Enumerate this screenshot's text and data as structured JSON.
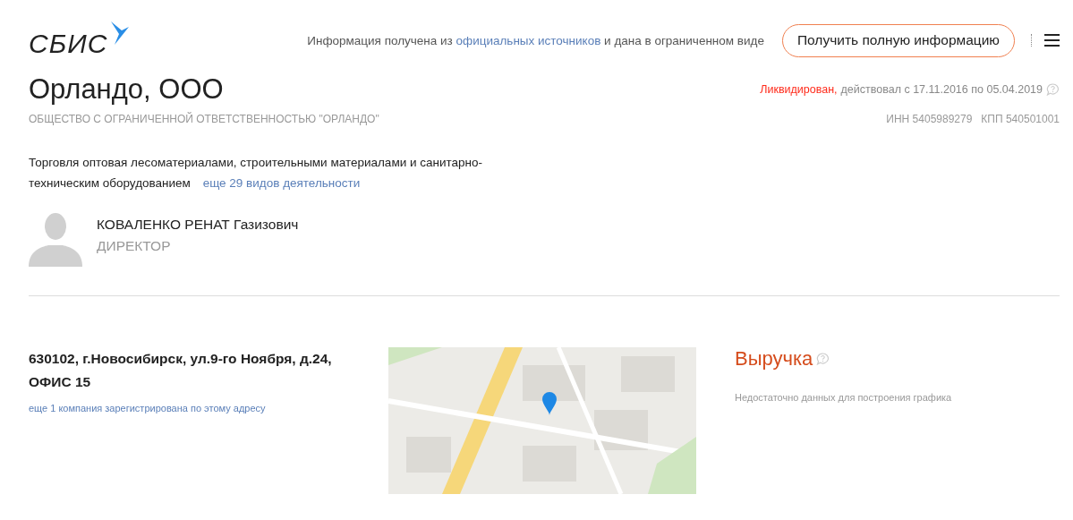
{
  "header": {
    "logo": "СБИС",
    "notice_before": "Информация получена из",
    "notice_link": "официальных источников",
    "notice_after": "и дана в ограниченном виде",
    "button": "Получить полную информацию"
  },
  "company": {
    "name": "Орландо, ООО",
    "full_name": "ОБЩЕСТВО С ОГРАНИЧЕННОЙ ОТВЕТСТВЕННОСТЬЮ \"ОРЛАНДО\"",
    "status": "Ликвидирован,",
    "period": "действовал с 17.11.2016 по 05.04.2019",
    "inn": "ИНН 5405989279",
    "kpp": "КПП 540501001"
  },
  "activity": {
    "text": "Торговля оптовая лесоматериалами, строительными материалами и санитарно-техническим оборудованием",
    "more_link": "еще 29 видов деятельности"
  },
  "director": {
    "name": "КОВАЛЕНКО РЕНАТ Газизович",
    "role": "ДИРЕКТОР"
  },
  "address": {
    "text": "630102, г.Новосибирск, ул.9-го Ноября, д.24, ОФИС 15",
    "more_link": "еще 1 компания зарегистрирована по этому адресу"
  },
  "revenue": {
    "title": "Выручка",
    "note": "Недостаточно данных для построения графика"
  }
}
